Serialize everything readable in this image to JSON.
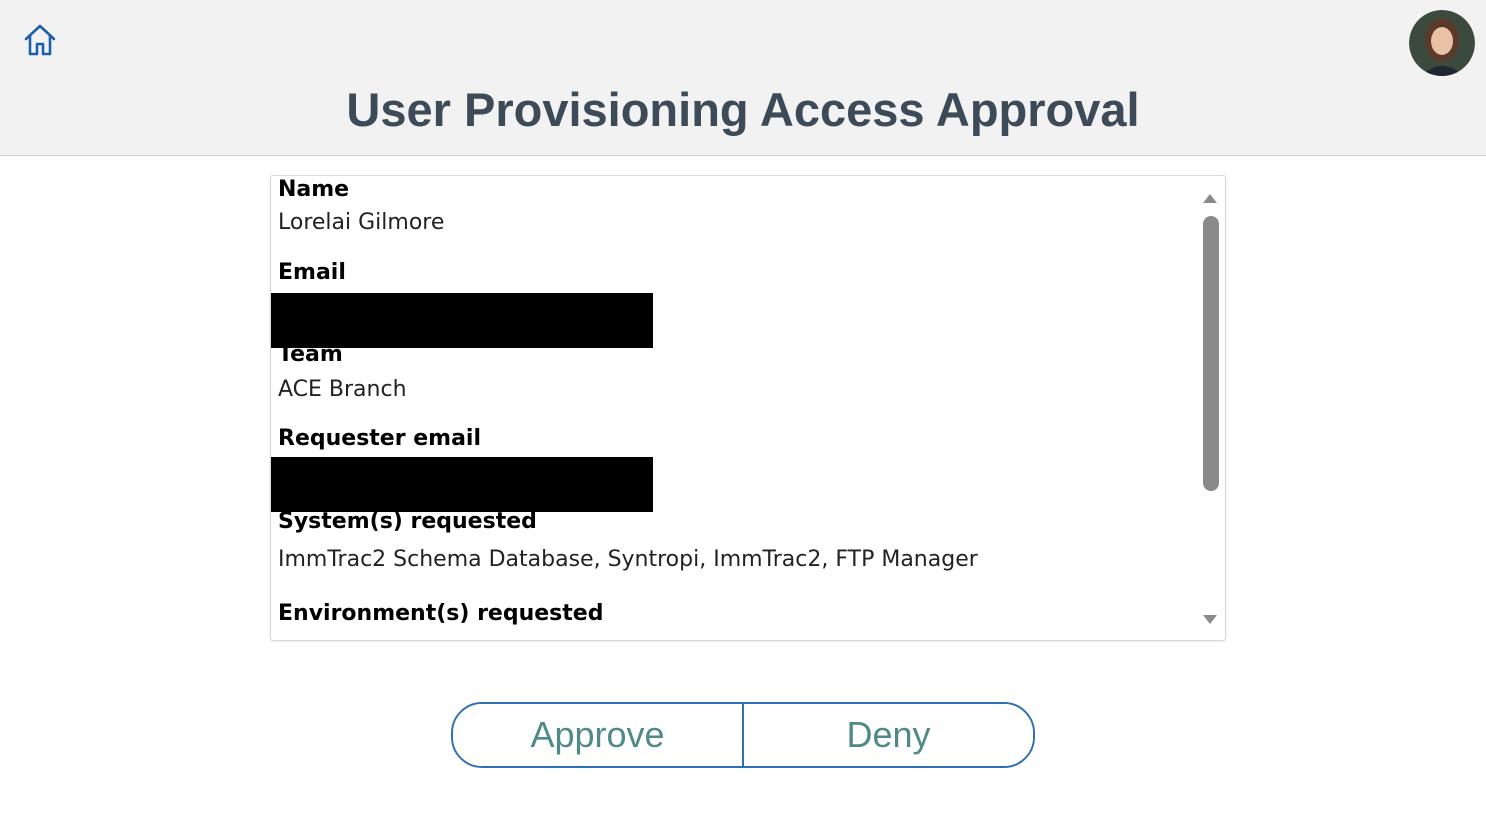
{
  "header": {
    "title": "User Provisioning Access Approval",
    "home_icon": "home-icon",
    "avatar": "user-avatar"
  },
  "details": {
    "fields": [
      {
        "label": "Name",
        "value": "Lorelai Gilmore"
      },
      {
        "label": "Email",
        "value": ""
      },
      {
        "label": "Team",
        "value": "ACE Branch"
      },
      {
        "label": "Requester email",
        "value": ""
      },
      {
        "label": "System(s) requested",
        "value": "ImmTrac2 Schema Database, Syntropi, ImmTrac2, FTP Manager"
      },
      {
        "label": "Environment(s) requested",
        "value": ""
      }
    ]
  },
  "actions": {
    "approve_label": "Approve",
    "deny_label": "Deny"
  },
  "colors": {
    "header_bg": "#f2f2f2",
    "title": "#3d4a57",
    "button_border": "#2f6fb3",
    "button_text": "#4f8a86",
    "home_icon": "#1f5fa8"
  }
}
